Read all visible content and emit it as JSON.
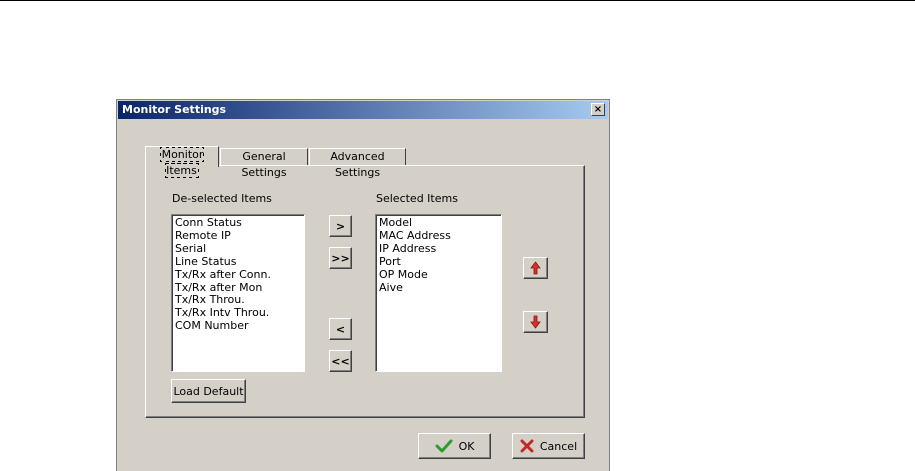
{
  "dialog": {
    "title": "Monitor Settings",
    "close_label": "×"
  },
  "tabs": [
    {
      "label": "Monitor Items",
      "active": true
    },
    {
      "label": "General Settings",
      "active": false
    },
    {
      "label": "Advanced Settings",
      "active": false
    }
  ],
  "deselected": {
    "label": "De-selected Items",
    "items": [
      "Conn Status",
      "Remote IP",
      "Serial",
      "Line Status",
      "Tx/Rx after Conn.",
      "Tx/Rx after Mon",
      "Tx/Rx Throu.",
      "Tx/Rx Intv Throu.",
      "COM Number"
    ]
  },
  "selected": {
    "label": "Selected Items",
    "items": [
      "Model",
      "MAC Address",
      "IP Address",
      "Port",
      "OP Mode",
      "Aive"
    ]
  },
  "move_buttons": {
    "add": ">",
    "add_all": ">>",
    "remove": "<",
    "remove_all": "<<"
  },
  "load_default_label": "Load Default",
  "ok_label": "OK",
  "cancel_label": "Cancel",
  "colors": {
    "title_gradient_start": "#0a246a",
    "title_gradient_end": "#a6caf0",
    "dialog_face": "#d4d0c8",
    "ok_check": "#2e9b2e",
    "cancel_x": "#c0282a",
    "move_arrow": "#d83030"
  }
}
